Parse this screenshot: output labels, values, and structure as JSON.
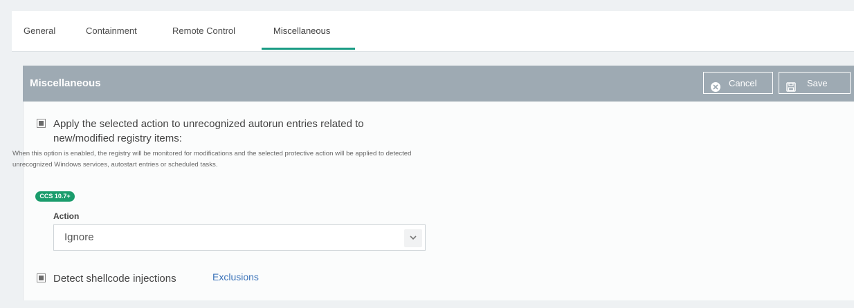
{
  "tabs": [
    {
      "label": "General"
    },
    {
      "label": "Containment"
    },
    {
      "label": "Remote Control"
    },
    {
      "label": "Miscellaneous",
      "active": true
    }
  ],
  "panel": {
    "title": "Miscellaneous",
    "cancel_label": "Cancel",
    "save_label": "Save"
  },
  "options": {
    "autorun": {
      "checked": true,
      "label_line1": "Apply the selected action to unrecognized autorun entries related to",
      "label_line2": "new/modified registry items:",
      "description": "When this option is enabled, the registry will be monitored for modifications and the selected protective action will be applied to detected unrecognized Windows services, autostart entries or scheduled tasks.",
      "badge": "CCS 10.7+",
      "action_label": "Action",
      "action_value": "Ignore"
    },
    "shellcode": {
      "checked": true,
      "label": "Detect shellcode injections",
      "link": "Exclusions"
    }
  },
  "colors": {
    "accent": "#1a9c84",
    "header_bg": "#9eaab3",
    "badge_bg": "#1a9c6c",
    "link": "#3b73b9"
  },
  "icons": [
    "cancel-circle-icon",
    "save-floppy-icon",
    "chevron-down-icon"
  ]
}
